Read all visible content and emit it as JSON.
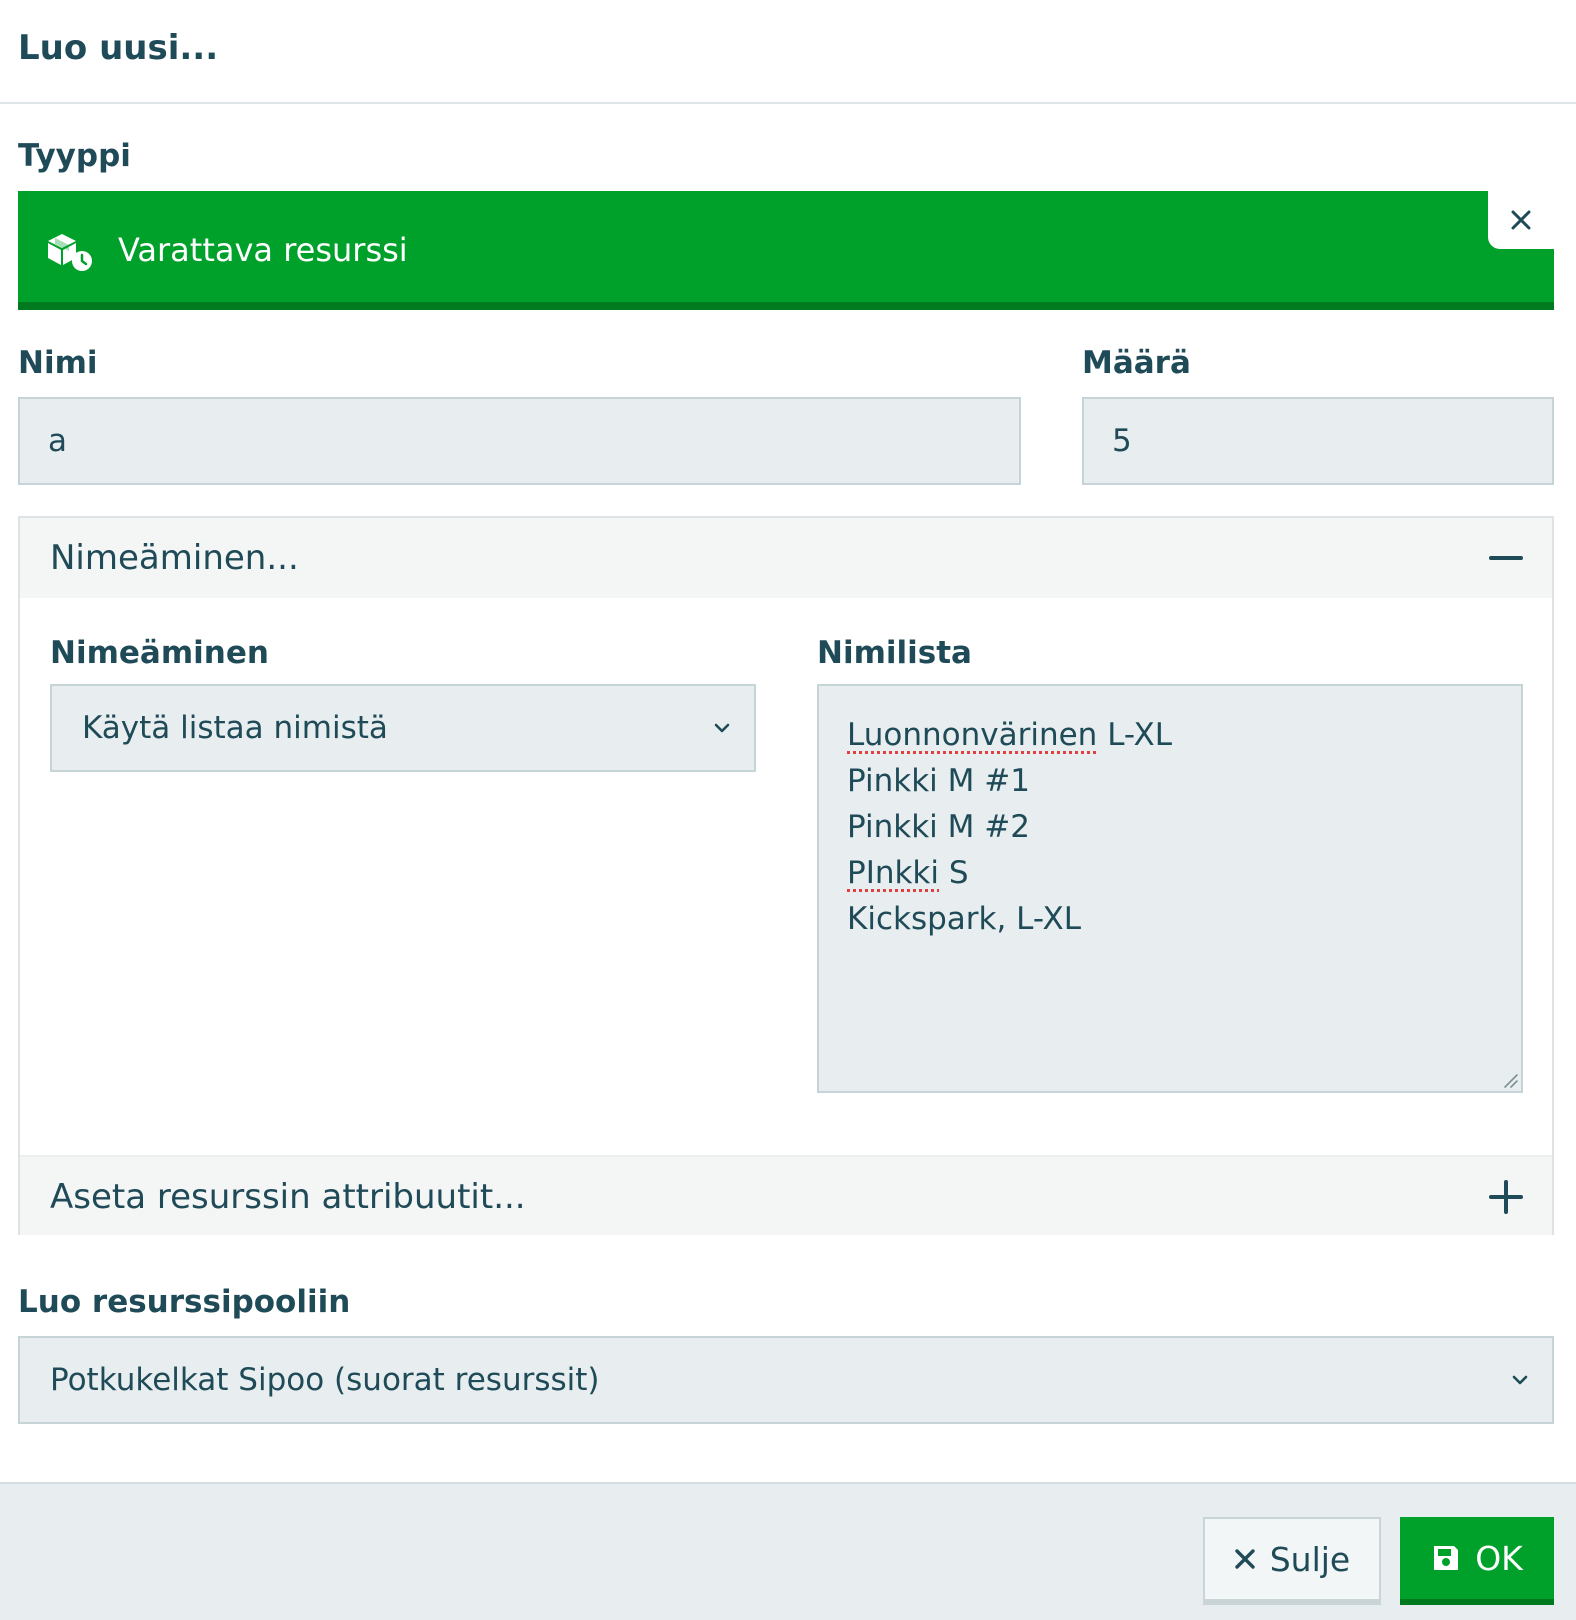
{
  "dialog": {
    "title": "Luo uusi..."
  },
  "type": {
    "label": "Tyyppi",
    "value": "Varattava resurssi",
    "icon": "box-clock-icon",
    "accent": "#00a12a"
  },
  "fields": {
    "name_label": "Nimi",
    "name_value": "a",
    "amount_label": "Määrä",
    "amount_value": "5"
  },
  "naming_panel": {
    "header": "Nimeäminen...",
    "naming_label": "Nimeäminen",
    "naming_value": "Käytä listaa nimistä",
    "namelist_label": "Nimilista",
    "names": [
      "Luonnonvärinen",
      "L-XL",
      "Pinkki M #1",
      "Pinkki M #2",
      "PInkki",
      "S",
      "Kickspark, L-XL"
    ]
  },
  "attributes_panel": {
    "header": "Aseta resurssin attribuutit..."
  },
  "pool": {
    "label": "Luo resurssipooliin",
    "value": "Potkukelkat Sipoo (suorat resurssit)"
  },
  "footer": {
    "close_label": "Sulje",
    "ok_label": "OK"
  }
}
